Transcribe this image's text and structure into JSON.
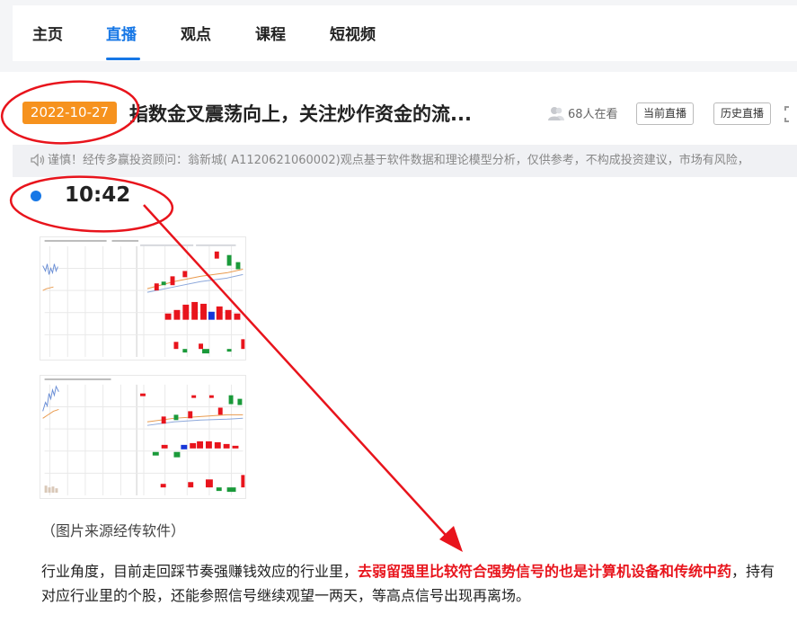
{
  "nav": {
    "tabs": [
      {
        "label": "主页"
      },
      {
        "label": "直播"
      },
      {
        "label": "观点"
      },
      {
        "label": "课程"
      },
      {
        "label": "短视频"
      }
    ],
    "active_tab": "直播"
  },
  "live": {
    "date": "2022-10-27",
    "title": "指数金叉震荡向上，关注炒作资金的流...",
    "viewers": "68人在看",
    "current_button": "当前直播",
    "history_button": "历史直播"
  },
  "notice": {
    "text": "谨慎！经传多赢投资顾问：翁新城( A1120621060002)观点基于软件数据和理论模型分析，仅供参考，不构成投资建议，市场有风险，"
  },
  "post": {
    "time": "10:42",
    "image_caption": "（图片来源经传软件）",
    "text_before": "行业角度，目前走回踩节奏强赚钱效应的行业里，",
    "text_highlight": "去弱留强里比较符合强势信号的也是计算机设备和传统中药",
    "text_after": "，持有对应行业里的个股，还能参照信号继续观望一两天，等高点信号出现再离场。"
  },
  "colors": {
    "accent": "#1677e6",
    "date_badge": "#f6921e",
    "highlight": "#e8141c",
    "annotation": "#e8141c"
  }
}
